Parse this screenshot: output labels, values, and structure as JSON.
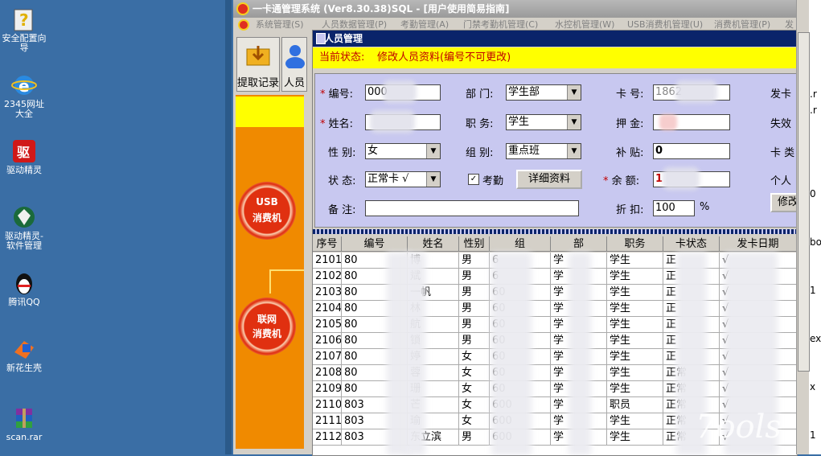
{
  "desktop": {
    "icons": [
      {
        "label": "安全配置向导",
        "icon": "shield-question-icon"
      },
      {
        "label": "2345网址大全",
        "icon": "ie-browser-icon"
      },
      {
        "label": "驱动精灵",
        "icon": "driver-genius-icon"
      },
      {
        "label": "驱动精灵-软件管理",
        "icon": "software-manager-icon"
      },
      {
        "label": "腾讯QQ",
        "icon": "qq-penguin-icon"
      },
      {
        "label": "新花生壳",
        "icon": "peanut-shell-icon"
      },
      {
        "label": "scan.rar",
        "icon": "winrar-archive-icon"
      }
    ]
  },
  "app": {
    "title": "一卡通管理系统 (Ver8.30.38)SQL - [用户使用简易指南]",
    "menu": [
      "系统管理(S)",
      "人员数据管理(P)",
      "考勤管理(A)",
      "门禁考勤机管理(C)",
      "水控机管理(W)",
      "USB消费机管理(U)",
      "消费机管理(P)",
      "发"
    ],
    "toolbar": [
      {
        "label": "提取记录",
        "icon": "folder-download-icon"
      },
      {
        "label": "人员",
        "icon": "person-icon"
      }
    ],
    "side_buttons": [
      {
        "line1": "USB",
        "line2": "消费机"
      },
      {
        "line1": "联网",
        "line2": "消费机"
      }
    ]
  },
  "dialog": {
    "title": "人员管理",
    "status_label": "当前状态:",
    "status_text": "修改人员资料(编号不可更改)",
    "fields": {
      "id_label": "编号:",
      "id_value": "000",
      "dept_label": "部 门:",
      "dept_value": "学生部",
      "card_label": "卡 号:",
      "card_value": "1862",
      "issue_label": "发卡",
      "name_label": "姓名:",
      "name_value": "",
      "position_label": "职 务:",
      "position_value": "学生",
      "deposit_label": "押 金:",
      "deposit_value": "",
      "expire_label": "失效",
      "gender_label": "性 别:",
      "gender_value": "女",
      "group_label": "组 别:",
      "group_value": "重点班",
      "subsidy_label": "补 贴:",
      "subsidy_value": "0",
      "cardtype_label": "卡 类",
      "state_label": "状 态:",
      "state_value": "正常卡 √",
      "attendance_label": "考勤",
      "attendance_checked": "✓",
      "detail_button": "详细资料",
      "balance_label": "余 额:",
      "balance_value": "1",
      "personal_label": "个人",
      "remark_label": "备 注:",
      "remark_value": "",
      "discount_label": "折 扣:",
      "discount_value": "100",
      "discount_unit": "%",
      "modify_button": "修改"
    },
    "table": {
      "headers": [
        "序号",
        "编号",
        "姓名",
        "性别",
        "组",
        "部",
        "职务",
        "卡状态",
        "发卡日期"
      ],
      "rows": [
        [
          "2101",
          "80",
          "博",
          "男",
          "6",
          "学",
          "学生",
          "正",
          "√"
        ],
        [
          "2102",
          "80",
          "斌",
          "男",
          "6",
          "学",
          "学生",
          "正",
          "√"
        ],
        [
          "2103",
          "80",
          "一帆",
          "男",
          "60",
          "学",
          "学生",
          "正",
          "√"
        ],
        [
          "2104",
          "80",
          "林",
          "男",
          "60",
          "学",
          "学生",
          "正",
          "√"
        ],
        [
          "2105",
          "80",
          "航",
          "男",
          "60",
          "学",
          "学生",
          "正",
          "√"
        ],
        [
          "2106",
          "80",
          "锁",
          "男",
          "60",
          "学",
          "学生",
          "正",
          "√"
        ],
        [
          "2107",
          "80",
          "婷",
          "女",
          "60",
          "学",
          "学生",
          "正",
          "√"
        ],
        [
          "2108",
          "80",
          "蓉",
          "女",
          "60",
          "学",
          "学生",
          "正常",
          "√"
        ],
        [
          "2109",
          "80",
          "珊",
          "女",
          "60",
          "学",
          "学生",
          "正常",
          "√"
        ],
        [
          "2110",
          "803",
          "芒",
          "女",
          "600",
          "学",
          "职员",
          "正常",
          "√"
        ],
        [
          "2111",
          "803",
          "瑜",
          "女",
          "600",
          "学",
          "学生",
          "正常",
          "√"
        ],
        [
          "2112",
          "803",
          "东立滨",
          "男",
          "600",
          "学",
          "学生",
          "正常",
          "√"
        ]
      ]
    }
  },
  "right_panel": {
    "snippets": [
      ".r",
      ".r",
      "0",
      "bo",
      "1",
      "ex",
      "x",
      "1"
    ]
  },
  "watermark": "7ools",
  "colors": {
    "status_bg": "#ffff00",
    "status_text": "#c00000",
    "form_bg": "#c8c8f0",
    "title_bar": "#0a246a",
    "orange": "#f08a00",
    "desktop": "#3a6ea5"
  }
}
